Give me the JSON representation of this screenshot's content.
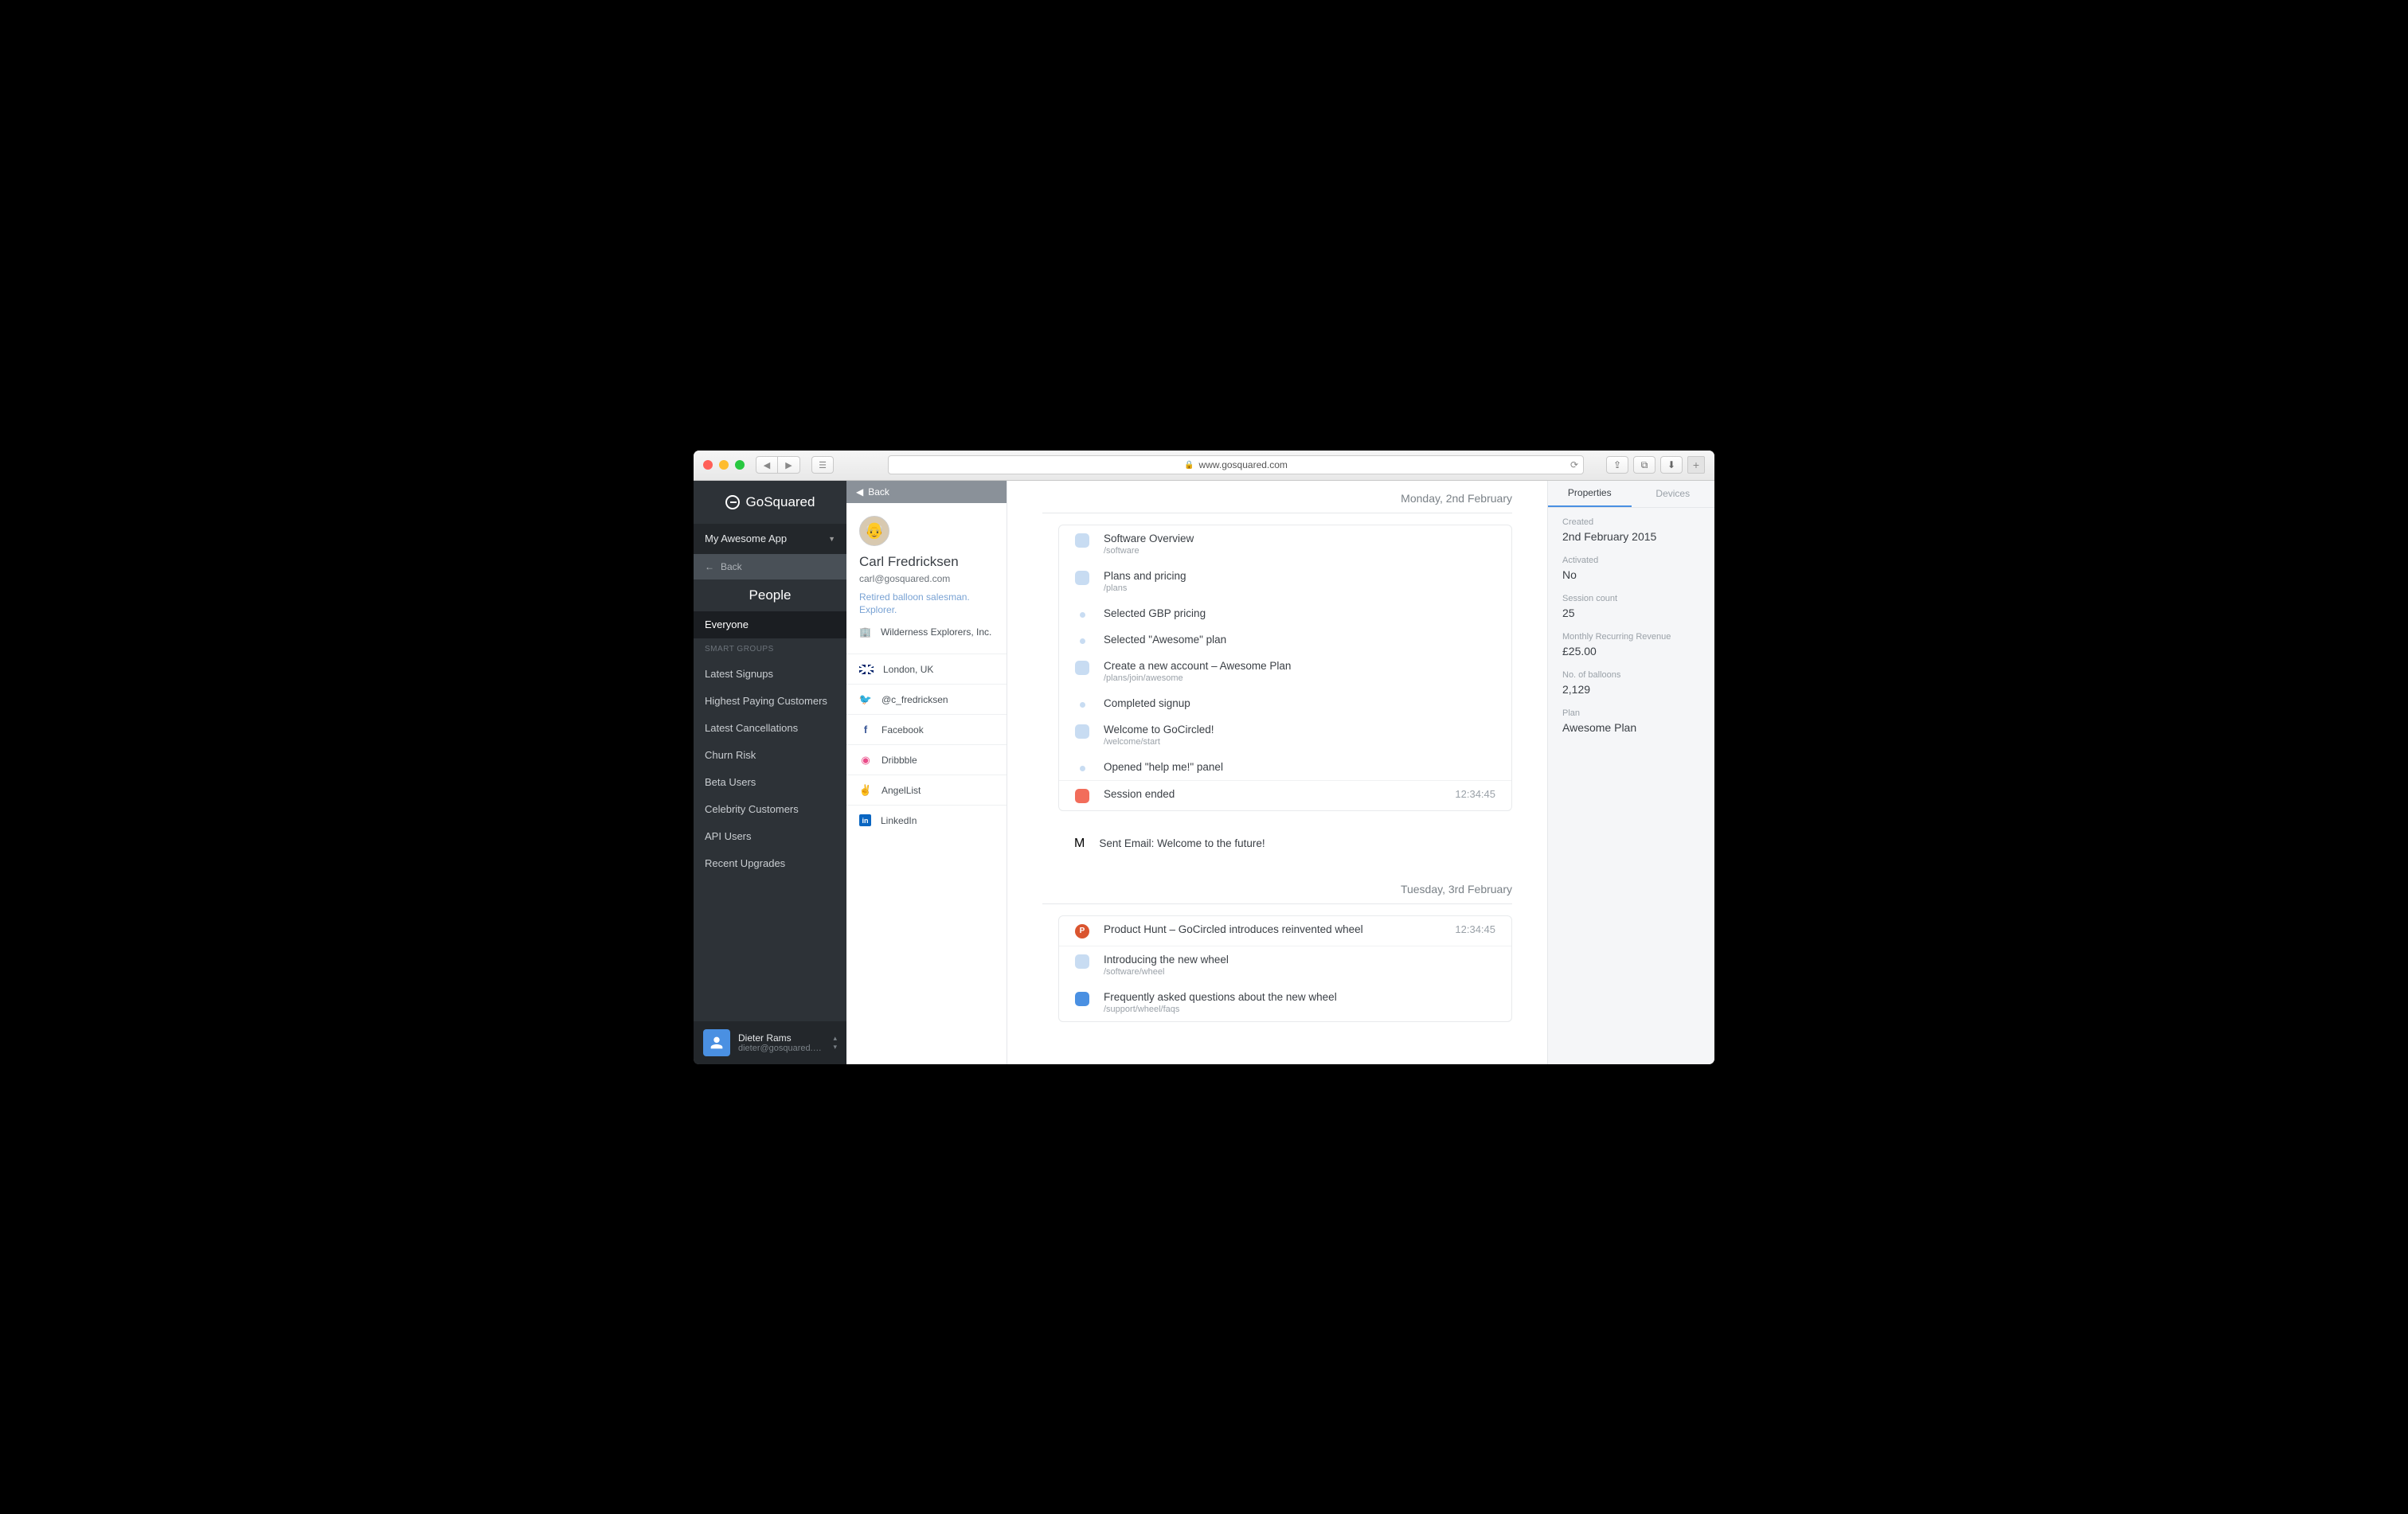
{
  "browser": {
    "url": "www.gosquared.com"
  },
  "brand": "GoSquared",
  "app_select": "My Awesome App",
  "nav_back": "Back",
  "section": "People",
  "smart_groups_label": "SMART GROUPS",
  "sidebar": {
    "items": [
      {
        "label": "Everyone",
        "active": true
      },
      {
        "label": "Latest Signups"
      },
      {
        "label": "Highest Paying Customers"
      },
      {
        "label": "Latest Cancellations"
      },
      {
        "label": "Churn Risk"
      },
      {
        "label": "Beta Users"
      },
      {
        "label": "Celebrity Customers"
      },
      {
        "label": "API Users"
      },
      {
        "label": "Recent Upgrades"
      }
    ]
  },
  "footer_user": {
    "name": "Dieter Rams",
    "email": "dieter@gosquared.…"
  },
  "profile": {
    "back": "Back",
    "name": "Carl Fredricksen",
    "email": "carl@gosquared.com",
    "bio": "Retired balloon salesman. Explorer.",
    "company": "Wilderness Explorers, Inc.",
    "links": [
      {
        "icon": "flag",
        "label": "London, UK"
      },
      {
        "icon": "twitter",
        "label": "@c_fredricksen"
      },
      {
        "icon": "facebook",
        "label": "Facebook"
      },
      {
        "icon": "dribbble",
        "label": "Dribbble"
      },
      {
        "icon": "angellist",
        "label": "AngelList"
      },
      {
        "icon": "linkedin",
        "label": "LinkedIn"
      }
    ]
  },
  "timeline": {
    "days": [
      {
        "date": "Monday, 2nd  February",
        "session": [
          {
            "kind": "page",
            "title": "Software Overview",
            "sub": "/software"
          },
          {
            "kind": "page",
            "title": "Plans and pricing",
            "sub": "/plans"
          },
          {
            "kind": "dot",
            "title": "Selected GBP pricing"
          },
          {
            "kind": "dot",
            "title": "Selected \"Awesome\" plan"
          },
          {
            "kind": "page",
            "title": "Create a new account – Awesome Plan",
            "sub": "/plans/join/awesome"
          },
          {
            "kind": "dot",
            "title": "Completed signup"
          },
          {
            "kind": "page",
            "title": "Welcome to GoCircled!",
            "sub": "/welcome/start"
          },
          {
            "kind": "dot",
            "title": "Opened \"help me!\" panel"
          },
          {
            "kind": "end",
            "title": "Session ended",
            "time": "12:34:45",
            "sep": true
          }
        ],
        "outside": [
          {
            "kind": "mail",
            "title": "Sent Email: Welcome to the future!"
          }
        ]
      },
      {
        "date": "Tuesday, 3rd  February",
        "session": [
          {
            "kind": "ph",
            "title": "Product Hunt – GoCircled introduces reinvented wheel",
            "time": "12:34:45"
          },
          {
            "kind": "page",
            "title": "Introducing the new wheel",
            "sub": "/software/wheel",
            "sep": true
          },
          {
            "kind": "dark",
            "title": "Frequently asked questions about the new wheel",
            "sub": "/support/wheel/faqs"
          }
        ]
      }
    ]
  },
  "properties": {
    "tabs": [
      "Properties",
      "Devices"
    ],
    "items": [
      {
        "label": "Created",
        "value": "2nd February 2015"
      },
      {
        "label": "Activated",
        "value": "No"
      },
      {
        "label": "Session count",
        "value": "25"
      },
      {
        "label": "Monthly Recurring Revenue",
        "value": "£25.00"
      },
      {
        "label": "No. of balloons",
        "value": "2,129"
      },
      {
        "label": "Plan",
        "value": "Awesome Plan"
      }
    ]
  }
}
